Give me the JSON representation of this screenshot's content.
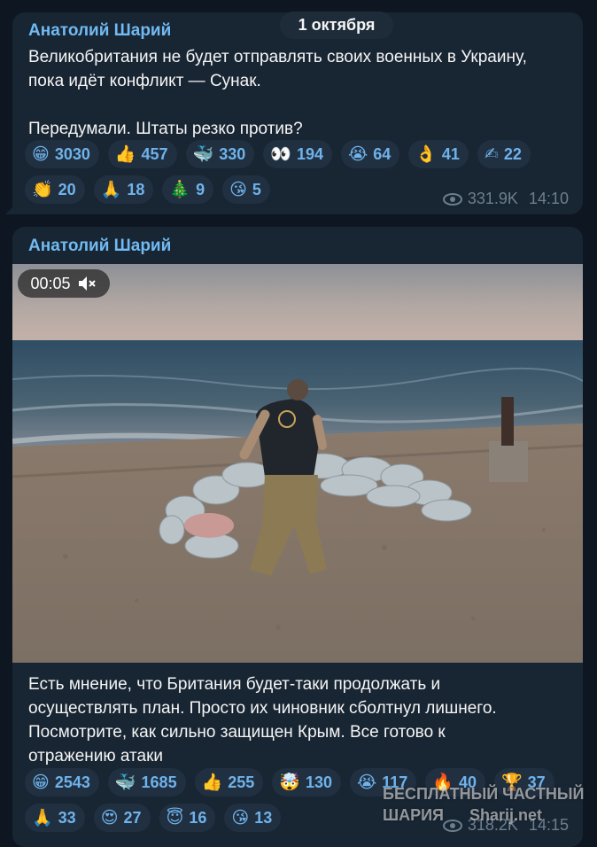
{
  "date_separator": "1 октября",
  "messages": [
    {
      "author": "Анатолий Шарий",
      "text": "Великобритания не будет отправлять своих военных в Украину,\nпока идёт конфликт — Сунак.\n\nПередумали. Штаты резко против?",
      "reactions": [
        {
          "emoji": "😁",
          "count": "3030"
        },
        {
          "emoji": "👍",
          "count": "457"
        },
        {
          "emoji": "🐳",
          "count": "330"
        },
        {
          "emoji": "👀",
          "count": "194"
        },
        {
          "emoji": "😭",
          "count": "64"
        },
        {
          "emoji": "👌",
          "count": "41"
        },
        {
          "emoji": "✍",
          "count": "22"
        },
        {
          "emoji": "👏",
          "count": "20"
        },
        {
          "emoji": "🙏",
          "count": "18"
        },
        {
          "emoji": "🎄",
          "count": "9"
        },
        {
          "emoji": "😘",
          "count": "5"
        }
      ],
      "views": "331.9K",
      "time": "14:10"
    },
    {
      "author": "Анатолий Шарий",
      "video_time": "00:05",
      "text": "Есть мнение, что Британия будет-таки продолжать и\nосуществлять план. Просто их чиновник сболтнул лишнего.\nПосмотрите, как сильно защищен Крым. Все готово к\nотражению атаки",
      "reactions": [
        {
          "emoji": "😁",
          "count": "2543"
        },
        {
          "emoji": "🐳",
          "count": "1685"
        },
        {
          "emoji": "👍",
          "count": "255"
        },
        {
          "emoji": "🤯",
          "count": "130"
        },
        {
          "emoji": "😭",
          "count": "117"
        },
        {
          "emoji": "🔥",
          "count": "40"
        },
        {
          "emoji": "🏆",
          "count": "37"
        },
        {
          "emoji": "🙏",
          "count": "33"
        },
        {
          "emoji": "😍",
          "count": "27"
        },
        {
          "emoji": "😇",
          "count": "16"
        },
        {
          "emoji": "😘",
          "count": "13"
        }
      ],
      "views": "318.2K",
      "time": "14:15"
    }
  ],
  "watermark": {
    "line1": "БЕСПЛАТНЫЙ ЧАСТНЫЙ",
    "line2": "ШАРИЯ",
    "site": "Sharij.net"
  },
  "icons": {
    "views": "eye-icon",
    "mute": "speaker-muted-icon"
  }
}
